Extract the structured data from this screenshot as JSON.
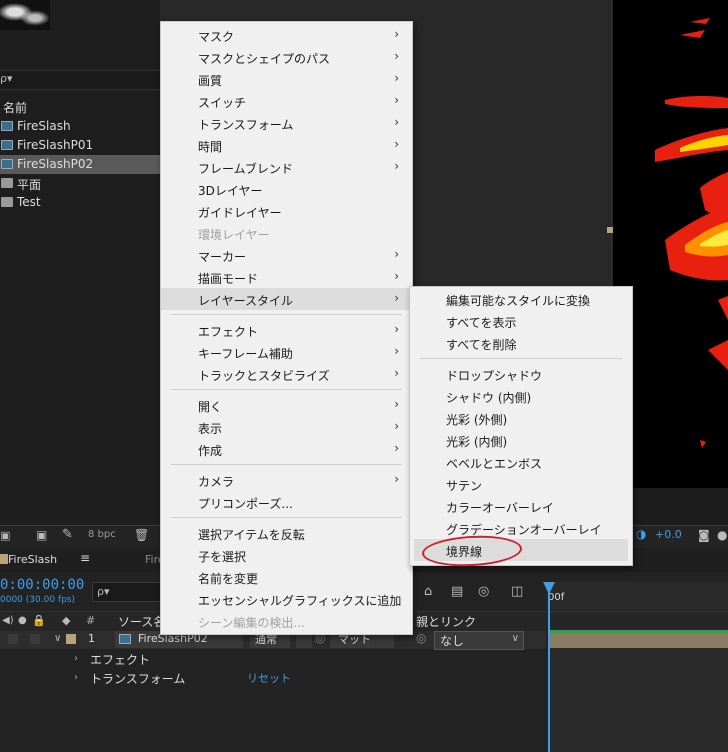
{
  "project": {
    "search_placeholder": "ρ▾",
    "name_header": "名前",
    "items": [
      {
        "label": "FireSlash",
        "type": "comp"
      },
      {
        "label": "FireSlashP01",
        "type": "comp"
      },
      {
        "label": "FireSlashP02",
        "type": "comp",
        "selected": true
      },
      {
        "label": "平面",
        "type": "folder"
      },
      {
        "label": "Test",
        "type": "folder"
      }
    ]
  },
  "toolbar": {
    "bpc": "8 bpc",
    "exposure": "+0.0"
  },
  "timeline": {
    "tab_name": "FireSlash",
    "tab_menu": "≡",
    "tab_name2": "Fire",
    "timecode": "0:00:00:00",
    "fps": "0000 (30.00 fps)",
    "search_placeholder": "ρ▾",
    "col_hash": "#",
    "col_source": "ソース名",
    "col_parent": "親とリンク",
    "ruler_start": "00f",
    "layer": {
      "number": "1",
      "name": "FireSlashP02",
      "mode": "通常",
      "matte": "マット",
      "parent": "なし"
    },
    "props": {
      "effect": "エフェクト",
      "transform": "トランスフォーム",
      "reset": "リセット"
    }
  },
  "context_menu": {
    "items": [
      {
        "label": "マスク",
        "submenu": true
      },
      {
        "label": "マスクとシェイプのパス",
        "submenu": true
      },
      {
        "label": "画質",
        "submenu": true
      },
      {
        "label": "スイッチ",
        "submenu": true
      },
      {
        "label": "トランスフォーム",
        "submenu": true
      },
      {
        "label": "時間",
        "submenu": true
      },
      {
        "label": "フレームブレンド",
        "submenu": true
      },
      {
        "label": "3Dレイヤー",
        "submenu": false
      },
      {
        "label": "ガイドレイヤー",
        "submenu": false
      },
      {
        "label": "環境レイヤー",
        "submenu": false,
        "disabled": true
      },
      {
        "label": "マーカー",
        "submenu": true
      },
      {
        "label": "描画モード",
        "submenu": true
      },
      {
        "label": "レイヤースタイル",
        "submenu": true,
        "highlighted": true
      },
      {
        "label": "エフェクト",
        "submenu": true
      },
      {
        "label": "キーフレーム補助",
        "submenu": true
      },
      {
        "label": "トラックとスタビライズ",
        "submenu": true
      },
      {
        "label": "開く",
        "submenu": true
      },
      {
        "label": "表示",
        "submenu": true
      },
      {
        "label": "作成",
        "submenu": true
      },
      {
        "label": "カメラ",
        "submenu": true
      },
      {
        "label": "プリコンポーズ...",
        "submenu": false
      },
      {
        "label": "選択アイテムを反転",
        "submenu": false
      },
      {
        "label": "子を選択",
        "submenu": false
      },
      {
        "label": "名前を変更",
        "submenu": false
      },
      {
        "label": "エッセンシャルグラフィックスに追加",
        "submenu": false
      },
      {
        "label": "シーン編集の検出...",
        "submenu": false,
        "disabled": true
      }
    ]
  },
  "layer_style_submenu": {
    "items": [
      {
        "label": "編集可能なスタイルに変換"
      },
      {
        "label": "すべてを表示"
      },
      {
        "label": "すべてを削除"
      },
      {
        "label": "ドロップシャドウ"
      },
      {
        "label": "シャドウ (内側)"
      },
      {
        "label": "光彩 (外側)"
      },
      {
        "label": "光彩 (内側)"
      },
      {
        "label": "ベベルとエンボス"
      },
      {
        "label": "サテン"
      },
      {
        "label": "カラーオーバーレイ"
      },
      {
        "label": "グラデーションオーバーレイ"
      },
      {
        "label": "境界線",
        "highlighted": true
      }
    ]
  },
  "colors": {
    "accent": "#3f9ee8",
    "annotation": "#d0202a",
    "menu_bg": "#f0f0f0"
  }
}
